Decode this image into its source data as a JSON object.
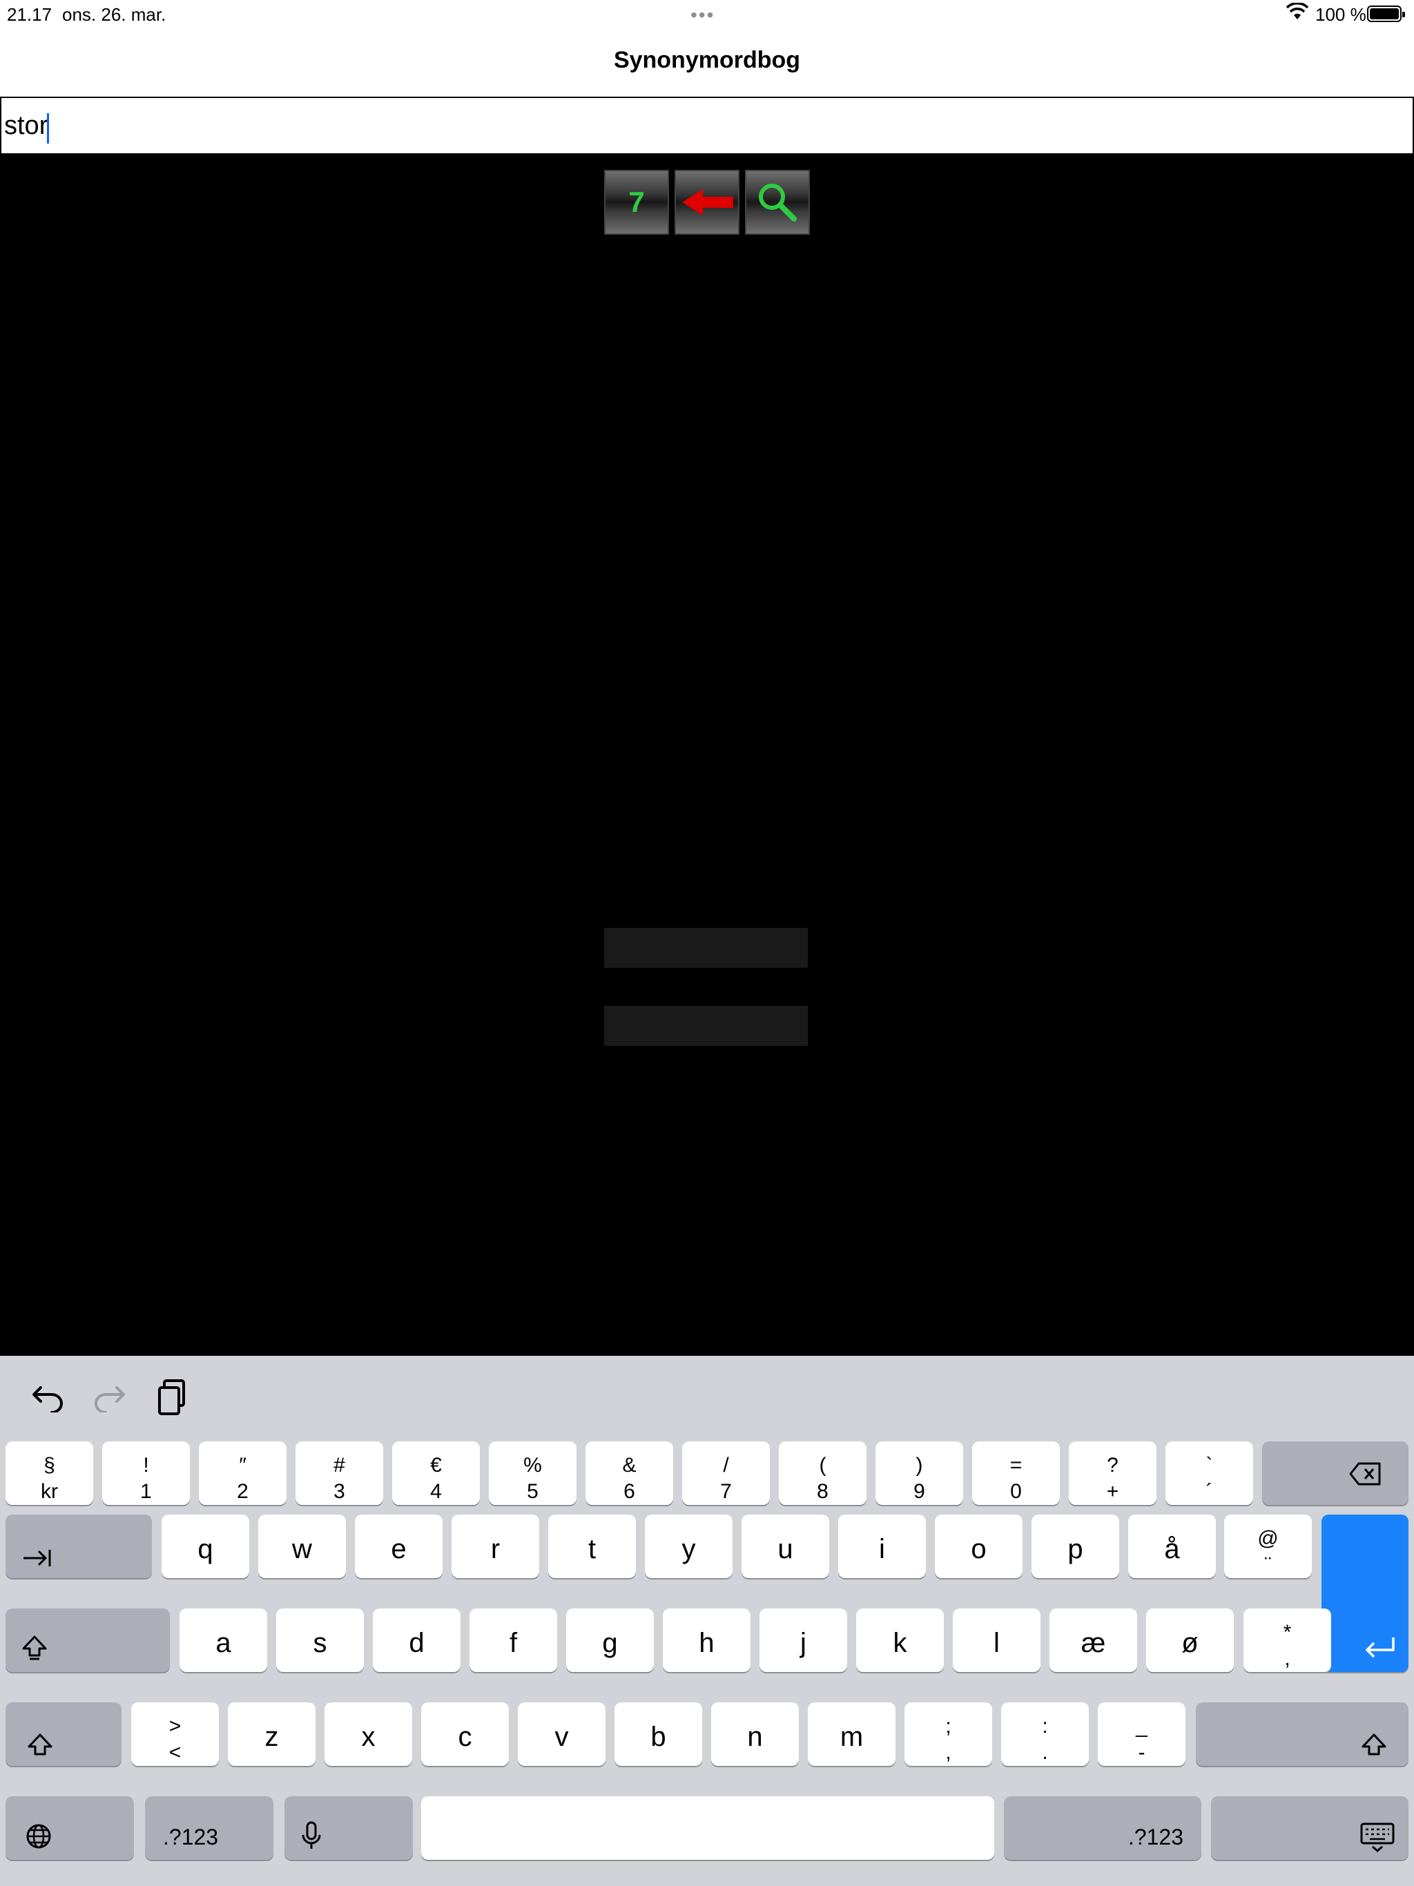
{
  "status": {
    "time": "21.17",
    "date": "ons. 26. mar.",
    "battery": "100 %"
  },
  "app": {
    "title": "Synonymordbog"
  },
  "search": {
    "value": "stor"
  },
  "toolbar": {
    "result_count": "7"
  },
  "keyboard": {
    "row1": [
      {
        "top": "§",
        "bottom": "kr"
      },
      {
        "top": "!",
        "bottom": "1"
      },
      {
        "top": "″",
        "bottom": "2"
      },
      {
        "top": "#",
        "bottom": "3"
      },
      {
        "top": "€",
        "bottom": "4"
      },
      {
        "top": "%",
        "bottom": "5"
      },
      {
        "top": "&",
        "bottom": "6"
      },
      {
        "top": "/",
        "bottom": "7"
      },
      {
        "top": "(",
        "bottom": "8"
      },
      {
        "top": ")",
        "bottom": "9"
      },
      {
        "top": "=",
        "bottom": "0"
      },
      {
        "top": "?",
        "bottom": "+"
      },
      {
        "top": "`",
        "bottom": "´"
      }
    ],
    "row2": [
      "q",
      "w",
      "e",
      "r",
      "t",
      "y",
      "u",
      "i",
      "o",
      "p",
      "å"
    ],
    "row2_at": {
      "top": "@",
      "bottom": "¨"
    },
    "row3": [
      "a",
      "s",
      "d",
      "f",
      "g",
      "h",
      "j",
      "k",
      "l",
      "æ",
      "ø"
    ],
    "row3_star": {
      "top": "*",
      "bottom": ","
    },
    "row4_angle": {
      "top": ">",
      "bottom": "<"
    },
    "row4": [
      "z",
      "x",
      "c",
      "v",
      "b",
      "n",
      "m"
    ],
    "row4_punct": [
      {
        "top": ";",
        "bottom": ","
      },
      {
        "top": ":",
        "bottom": "."
      },
      {
        "top": "_",
        "bottom": "-"
      }
    ],
    "numbers_label": ".?123"
  }
}
